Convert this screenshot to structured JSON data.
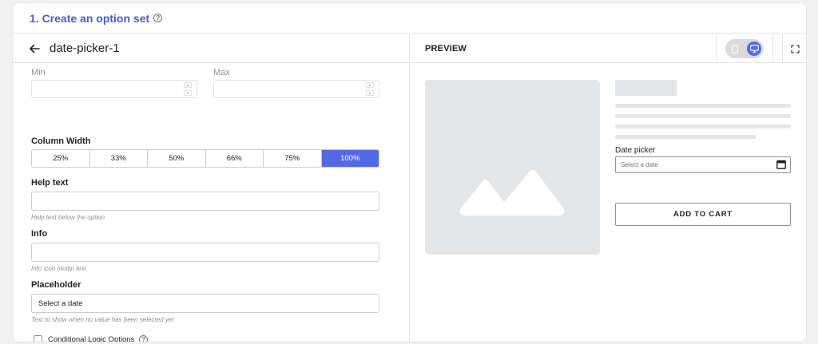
{
  "header": {
    "title": "1. Create an option set",
    "help_icon": "question-circle-icon"
  },
  "editor": {
    "back_icon": "arrow-left-icon",
    "title": "date-picker-1",
    "min_label": "Min",
    "max_label": "Max",
    "column_width": {
      "label": "Column Width",
      "options": [
        "25%",
        "33%",
        "50%",
        "66%",
        "75%",
        "100%"
      ],
      "selected": "100%"
    },
    "help_text": {
      "label": "Help text",
      "value": "",
      "hint": "Help text below the option"
    },
    "info": {
      "label": "Info",
      "value": "",
      "hint": "Info icon tooltip text"
    },
    "placeholder": {
      "label": "Placeholder",
      "value": "Select a date",
      "hint": "Text to show when no value has been selected yet"
    },
    "conditional_logic": {
      "label": "Conditional Logic Options",
      "checked": false
    }
  },
  "preview": {
    "title": "PREVIEW",
    "device_toggle": {
      "mobile_icon": "mobile-icon",
      "desktop_icon": "desktop-icon",
      "active": "desktop"
    },
    "fullscreen_icon": "fullscreen-icon",
    "date_picker_label": "Date picker",
    "date_picker_placeholder": "Select a date",
    "calendar_icon": "calendar-icon",
    "add_to_cart": "ADD TO CART"
  },
  "colors": {
    "accent": "#5469e6",
    "title": "#4a5bc4",
    "skeleton": "#e4e5e7"
  }
}
